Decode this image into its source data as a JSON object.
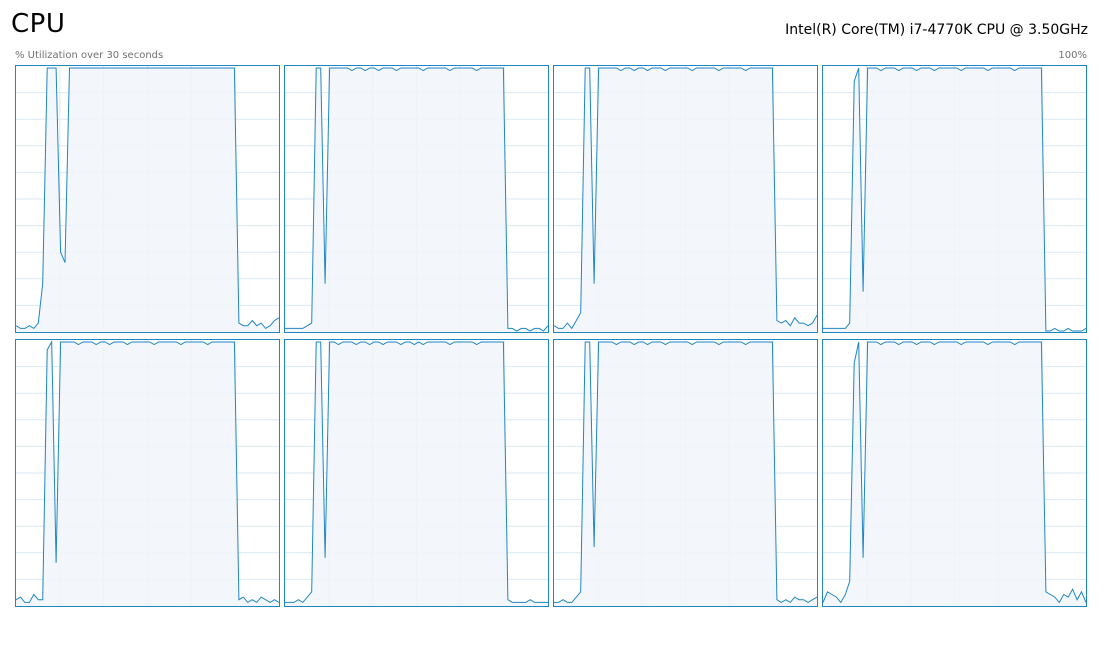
{
  "header": {
    "title": "CPU",
    "cpu_model": "Intel(R) Core(TM) i7-4770K CPU @ 3.50GHz",
    "utilization_label": "% Utilization over 30 seconds",
    "max_label": "100%"
  },
  "colors": {
    "line": "#1f86c4",
    "fill": "#f1f6fa",
    "grid": "#d9eaf4",
    "border": "#1f86c4"
  },
  "chart_data": {
    "type": "area",
    "y_range": [
      0,
      100
    ],
    "samples_per_core": 60,
    "grid": true,
    "cores": [
      {
        "values": [
          2,
          1,
          1,
          2,
          1,
          3,
          18,
          100,
          100,
          100,
          30,
          26,
          100,
          100,
          100,
          100,
          100,
          100,
          100,
          100,
          100,
          100,
          100,
          100,
          100,
          100,
          100,
          100,
          100,
          100,
          100,
          100,
          100,
          100,
          100,
          100,
          100,
          100,
          100,
          100,
          100,
          100,
          100,
          100,
          100,
          100,
          100,
          100,
          100,
          100,
          3,
          2,
          2,
          4,
          2,
          3,
          1,
          2,
          4,
          5
        ]
      },
      {
        "values": [
          1,
          1,
          1,
          1,
          1,
          2,
          3,
          100,
          100,
          18,
          100,
          100,
          100,
          100,
          100,
          99,
          100,
          100,
          99,
          100,
          100,
          99,
          100,
          100,
          100,
          99,
          100,
          100,
          100,
          100,
          100,
          99,
          100,
          100,
          100,
          100,
          100,
          99,
          100,
          100,
          100,
          100,
          100,
          99,
          100,
          100,
          100,
          100,
          100,
          100,
          1,
          1,
          0,
          1,
          1,
          0,
          1,
          1,
          0,
          2
        ]
      },
      {
        "values": [
          2,
          1,
          1,
          3,
          1,
          4,
          7,
          100,
          100,
          18,
          100,
          100,
          100,
          100,
          100,
          99,
          100,
          100,
          99,
          100,
          100,
          99,
          100,
          100,
          100,
          99,
          100,
          100,
          100,
          100,
          100,
          99,
          100,
          100,
          100,
          100,
          100,
          99,
          100,
          100,
          100,
          100,
          100,
          99,
          100,
          100,
          100,
          100,
          100,
          100,
          4,
          3,
          4,
          2,
          5,
          3,
          3,
          2,
          3,
          6
        ]
      },
      {
        "values": [
          1,
          1,
          1,
          1,
          1,
          1,
          3,
          95,
          100,
          15,
          100,
          100,
          100,
          99,
          100,
          100,
          100,
          99,
          100,
          100,
          100,
          99,
          100,
          100,
          100,
          99,
          100,
          100,
          100,
          100,
          100,
          99,
          100,
          100,
          100,
          100,
          100,
          99,
          100,
          100,
          100,
          100,
          100,
          99,
          100,
          100,
          100,
          100,
          100,
          100,
          0,
          0,
          1,
          0,
          0,
          1,
          0,
          0,
          0,
          1
        ]
      },
      {
        "values": [
          2,
          3,
          1,
          1,
          4,
          2,
          2,
          97,
          100,
          16,
          100,
          100,
          100,
          100,
          99,
          100,
          100,
          100,
          99,
          100,
          100,
          99,
          100,
          100,
          100,
          99,
          100,
          100,
          100,
          100,
          100,
          99,
          100,
          100,
          100,
          100,
          100,
          99,
          100,
          100,
          100,
          100,
          100,
          99,
          100,
          100,
          100,
          100,
          100,
          100,
          2,
          3,
          1,
          2,
          1,
          3,
          2,
          1,
          2,
          1
        ]
      },
      {
        "values": [
          1,
          1,
          1,
          2,
          1,
          3,
          5,
          100,
          100,
          18,
          100,
          100,
          99,
          100,
          100,
          100,
          99,
          100,
          100,
          99,
          100,
          100,
          99,
          100,
          100,
          100,
          99,
          100,
          100,
          99,
          100,
          99,
          100,
          100,
          100,
          100,
          100,
          99,
          100,
          100,
          100,
          100,
          100,
          99,
          100,
          100,
          100,
          100,
          100,
          100,
          2,
          1,
          1,
          1,
          1,
          2,
          1,
          1,
          1,
          1
        ]
      },
      {
        "values": [
          1,
          1,
          2,
          1,
          1,
          3,
          5,
          100,
          100,
          22,
          100,
          100,
          100,
          100,
          99,
          100,
          100,
          100,
          99,
          100,
          100,
          99,
          100,
          100,
          100,
          99,
          100,
          100,
          100,
          100,
          100,
          99,
          100,
          100,
          100,
          100,
          100,
          99,
          100,
          100,
          100,
          100,
          100,
          99,
          100,
          100,
          100,
          100,
          100,
          100,
          2,
          1,
          2,
          1,
          3,
          2,
          2,
          1,
          2,
          3
        ]
      },
      {
        "values": [
          1,
          5,
          4,
          3,
          1,
          4,
          9,
          92,
          100,
          18,
          100,
          100,
          100,
          99,
          100,
          100,
          100,
          99,
          100,
          100,
          100,
          99,
          100,
          100,
          100,
          99,
          100,
          100,
          100,
          100,
          100,
          99,
          100,
          100,
          100,
          100,
          100,
          99,
          100,
          100,
          100,
          100,
          100,
          99,
          100,
          100,
          100,
          100,
          100,
          100,
          5,
          4,
          3,
          1,
          4,
          3,
          6,
          2,
          5,
          1
        ]
      }
    ]
  }
}
